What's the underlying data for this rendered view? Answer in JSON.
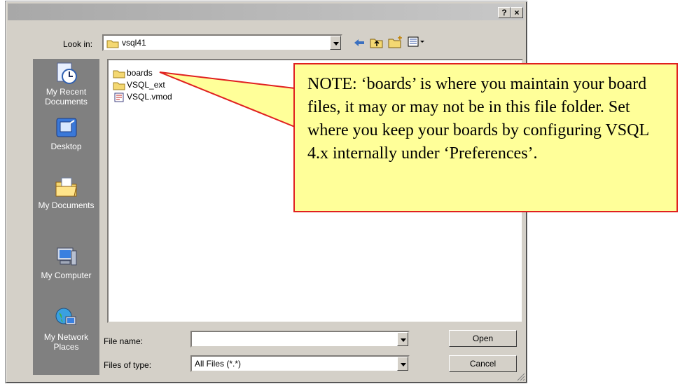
{
  "titlebar": {
    "help_button": "?",
    "close_button": "×"
  },
  "lookin": {
    "label": "Look in:",
    "value": "vsql41"
  },
  "toolbar": {
    "icons": [
      "back-arrow-icon",
      "up-folder-icon",
      "new-folder-icon",
      "view-menu-icon"
    ]
  },
  "places": [
    {
      "label": "My Recent\nDocuments",
      "icon": "recent-documents-icon"
    },
    {
      "label": "Desktop",
      "icon": "desktop-icon"
    },
    {
      "label": "My Documents",
      "icon": "my-documents-icon"
    },
    {
      "label": "My Computer",
      "icon": "my-computer-icon"
    },
    {
      "label": "My Network\nPlaces",
      "icon": "network-places-icon"
    }
  ],
  "files": [
    {
      "name": "boards",
      "icon": "folder-icon"
    },
    {
      "name": "VSQL_ext",
      "icon": "folder-icon"
    },
    {
      "name": "VSQL.vmod",
      "icon": "vmod-file-icon"
    }
  ],
  "filename": {
    "label": "File name:",
    "value": ""
  },
  "filetype": {
    "label": "Files of type:",
    "value": "All Files (*.*)"
  },
  "buttons": {
    "open": "Open",
    "cancel": "Cancel"
  },
  "note": {
    "text": "NOTE: ‘boards’ is where you maintain your board files, it may or may not be in this file folder.  Set where you keep your boards by configuring VSQL 4.x internally under ‘Preferences’."
  },
  "colors": {
    "callout_fill": "#ffff99",
    "callout_border": "#e02020",
    "places_bar": "#808080",
    "dialog_face": "#d4d0c8"
  }
}
